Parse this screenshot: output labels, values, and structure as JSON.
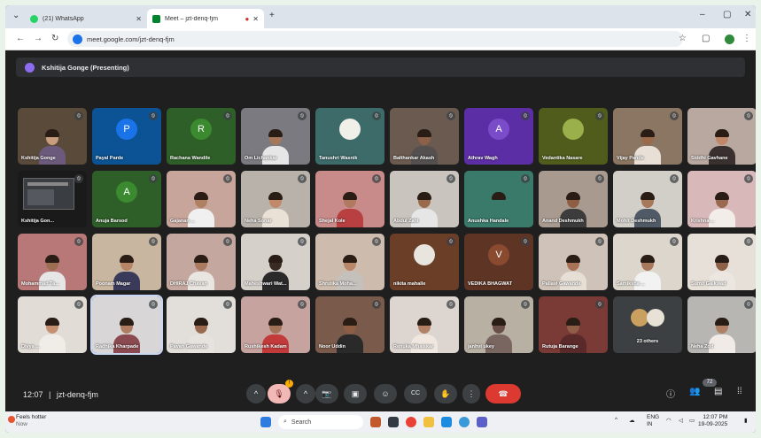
{
  "browser": {
    "tabs": [
      {
        "label": "(21) WhatsApp",
        "favicon_color": "#25d366"
      },
      {
        "label": "Meet – jzt-denq-fjm",
        "favicon_color": "#00832d"
      }
    ],
    "new_tab": "+",
    "url": "meet.google.com/jzt-denq-fjm",
    "window_controls": {
      "minimize": "–",
      "maximize": "▢",
      "close": "✕"
    }
  },
  "presenting_banner": "Kshitija Gonge (Presenting)",
  "participants": [
    {
      "name": "Kshitija Gonge",
      "type": "video",
      "bg": "#5a4a3a",
      "skin": "#c89e7e",
      "shirt": "#6c5a7c"
    },
    {
      "name": "Payal Parde",
      "type": "avatar",
      "initial": "P",
      "bg": "#0b5394",
      "avatar_color": "#1a73e8"
    },
    {
      "name": "Rachana Wandile",
      "type": "avatar",
      "initial": "R",
      "bg": "#2e5f28",
      "avatar_color": "#3b8a30"
    },
    {
      "name": "Om Lichankar",
      "type": "video",
      "bg": "#7a7a80",
      "skin": "#a5785a",
      "shirt": "#e6e6e6"
    },
    {
      "name": "Tanushri Wasnik",
      "type": "photo",
      "bg": "#3c6b6a",
      "avatar_color": "#f0efe8"
    },
    {
      "name": "Balthankar Akash",
      "type": "video",
      "bg": "#6b5a50",
      "skin": "#8d6048",
      "shirt": "#555050"
    },
    {
      "name": "Athrav Wagh",
      "type": "avatar",
      "initial": "A",
      "bg": "#5c2ea6",
      "avatar_color": "#7b4cc9"
    },
    {
      "name": "Vedantika Nasare",
      "type": "photo",
      "bg": "#4f5c1c",
      "avatar_color": "#9ab04a"
    },
    {
      "name": "Vijay Pande",
      "type": "video",
      "bg": "#8a7662",
      "skin": "#9b6a4a",
      "shirt": "#e8e0d6"
    },
    {
      "name": "Siddhi Gavhane",
      "type": "video",
      "bg": "#b8a8a0",
      "skin": "#c08868",
      "shirt": "#3a3030"
    },
    {
      "name": "Kshitija Gon...",
      "type": "screen",
      "bg": "#1a1a1a"
    },
    {
      "name": "Anuja Barsod",
      "type": "avatar",
      "initial": "A",
      "bg": "#2e5f28",
      "avatar_color": "#3b8a30"
    },
    {
      "name": "Gajanan ...",
      "type": "video",
      "bg": "#c7a59a",
      "skin": "#b08062",
      "shirt": "#f0f0f0"
    },
    {
      "name": "Neha Sonar",
      "type": "video",
      "bg": "#b9b2aa",
      "skin": "#c08a6a",
      "shirt": "#e9e0d6"
    },
    {
      "name": "Shejal Kole",
      "type": "video",
      "bg": "#c98a8a",
      "skin": "#b07a60",
      "shirt": "#b84040"
    },
    {
      "name": "Abdul Zahi",
      "type": "video",
      "bg": "#c9c4be",
      "skin": "#9a6a4c",
      "shirt": "#e6e6e6"
    },
    {
      "name": "Anushka Handale",
      "type": "video",
      "bg": "#3a7a6a",
      "skin": "#3a7a6a",
      "shirt": "#3a7a6a"
    },
    {
      "name": "Anand Deshmukh",
      "type": "video",
      "bg": "#a89a8e",
      "skin": "#8d5e44",
      "shirt": "#3c3c3c"
    },
    {
      "name": "Mohit Deshmukh",
      "type": "video",
      "bg": "#d2cec8",
      "skin": "#a7785a",
      "shirt": "#505a66"
    },
    {
      "name": "Krishna ...",
      "type": "video",
      "bg": "#d8b8b8",
      "skin": "#9a6a50",
      "shirt": "#f2ede8"
    },
    {
      "name": "Mohammad Ta...",
      "type": "video",
      "bg": "#b87878",
      "skin": "#9e6e52",
      "shirt": "#e6e6e6"
    },
    {
      "name": "Poonam Magar",
      "type": "video",
      "bg": "#c8b6a0",
      "skin": "#b88466",
      "shirt": "#3a3a5a"
    },
    {
      "name": "DHIRAJ Chavan",
      "type": "video",
      "bg": "#c4a8a0",
      "skin": "#aa7a5e",
      "shirt": "#e9e5e0"
    },
    {
      "name": "Maheshwari Wat...",
      "type": "video",
      "bg": "#d6d0ca",
      "skin": "#3a2a24",
      "shirt": "#2a2a2a"
    },
    {
      "name": "Shrutika Moha...",
      "type": "video",
      "bg": "#cdbcae",
      "skin": "#b88668",
      "shirt": "#c4c0bc"
    },
    {
      "name": "nikita mahalle",
      "type": "photo",
      "bg": "#6b3e28",
      "avatar_color": "#e8e4de"
    },
    {
      "name": "VEDIKA BHAGWAT",
      "type": "avatar",
      "initial": "V",
      "bg": "#5e3524",
      "avatar_color": "#8a4a30"
    },
    {
      "name": "Pallavi Gawande",
      "type": "video",
      "bg": "#cfc2b8",
      "skin": "#a87256",
      "shirt": "#e6dfd6"
    },
    {
      "name": "Samiksha ...",
      "type": "video",
      "bg": "#ddd6cc",
      "skin": "#a8785c",
      "shirt": "#f2f2f2"
    },
    {
      "name": "Sumit Gaikwad",
      "type": "video",
      "bg": "#e6e0d8",
      "skin": "#8e6046",
      "shirt": "#ebe6e0"
    },
    {
      "name": "Divya ...",
      "type": "video",
      "bg": "#e2dcd6",
      "skin": "#c59070",
      "shirt": "#f0ece8"
    },
    {
      "name": "Radhika Kharpade",
      "type": "video",
      "bg": "#d8d6d6",
      "skin": "#b07c62",
      "shirt": "#8a4a50",
      "selected": true
    },
    {
      "name": "Pavan Gawande",
      "type": "video",
      "bg": "#e2dfda",
      "skin": "#9a6a4e",
      "shirt": "#e6e2de"
    },
    {
      "name": "Rushikesh Kadam",
      "type": "video",
      "bg": "#c7a3a0",
      "skin": "#a27258",
      "shirt": "#c23a3a"
    },
    {
      "name": "Noor Uddin",
      "type": "video",
      "bg": "#7a5a4a",
      "skin": "#8e5e44",
      "shirt": "#2a2a2a"
    },
    {
      "name": "Renuka Mhaiskar",
      "type": "video",
      "bg": "#ddd6d0",
      "skin": "#b28064",
      "shirt": "#f0e8e0"
    },
    {
      "name": "janhvi ukey",
      "type": "video",
      "bg": "#b9b0a4",
      "skin": "#6a5048",
      "shirt": "#7a6660"
    },
    {
      "name": "Rutuja Barange",
      "type": "video",
      "bg": "#7a3a36",
      "skin": "#8e5e46",
      "shirt": "#5a2a2a"
    },
    {
      "name": "23 others",
      "type": "others"
    },
    {
      "name": "Neha Zod",
      "type": "video",
      "bg": "#b7b6b2",
      "skin": "#b08064",
      "shirt": "#f0ebe6"
    }
  ],
  "meeting": {
    "time": "12:07",
    "code": "jzt-denq-fjm",
    "participant_count": "72",
    "mic_notification": "!"
  },
  "controls": {
    "chevron": "^",
    "mic_icon": "🎙",
    "camera_icon": "📷",
    "present_icon": "▣",
    "emoji_icon": "☺",
    "captions_icon": "CC",
    "hand_icon": "✋",
    "more_icon": "⋮",
    "end_call_icon": "☎"
  },
  "right_icons": {
    "info": "ⓘ",
    "people": "👥",
    "chat": "▤",
    "activities": "⁞⁞"
  },
  "taskbar": {
    "weather_line1": "Feels hotter",
    "weather_line2": "Now",
    "search_placeholder": "Search",
    "tray_lang": "ENG",
    "tray_region": "IN",
    "clock_time": "12:07 PM",
    "clock_date": "19-09-2025"
  }
}
